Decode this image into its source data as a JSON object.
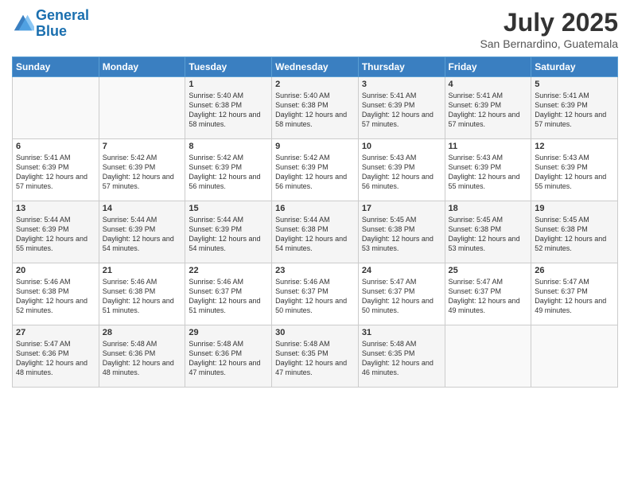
{
  "logo": {
    "line1": "General",
    "line2": "Blue"
  },
  "title": "July 2025",
  "subtitle": "San Bernardino, Guatemala",
  "days_header": [
    "Sunday",
    "Monday",
    "Tuesday",
    "Wednesday",
    "Thursday",
    "Friday",
    "Saturday"
  ],
  "weeks": [
    [
      {
        "num": "",
        "sunrise": "",
        "sunset": "",
        "daylight": ""
      },
      {
        "num": "",
        "sunrise": "",
        "sunset": "",
        "daylight": ""
      },
      {
        "num": "1",
        "sunrise": "Sunrise: 5:40 AM",
        "sunset": "Sunset: 6:38 PM",
        "daylight": "Daylight: 12 hours and 58 minutes."
      },
      {
        "num": "2",
        "sunrise": "Sunrise: 5:40 AM",
        "sunset": "Sunset: 6:38 PM",
        "daylight": "Daylight: 12 hours and 58 minutes."
      },
      {
        "num": "3",
        "sunrise": "Sunrise: 5:41 AM",
        "sunset": "Sunset: 6:39 PM",
        "daylight": "Daylight: 12 hours and 57 minutes."
      },
      {
        "num": "4",
        "sunrise": "Sunrise: 5:41 AM",
        "sunset": "Sunset: 6:39 PM",
        "daylight": "Daylight: 12 hours and 57 minutes."
      },
      {
        "num": "5",
        "sunrise": "Sunrise: 5:41 AM",
        "sunset": "Sunset: 6:39 PM",
        "daylight": "Daylight: 12 hours and 57 minutes."
      }
    ],
    [
      {
        "num": "6",
        "sunrise": "Sunrise: 5:41 AM",
        "sunset": "Sunset: 6:39 PM",
        "daylight": "Daylight: 12 hours and 57 minutes."
      },
      {
        "num": "7",
        "sunrise": "Sunrise: 5:42 AM",
        "sunset": "Sunset: 6:39 PM",
        "daylight": "Daylight: 12 hours and 57 minutes."
      },
      {
        "num": "8",
        "sunrise": "Sunrise: 5:42 AM",
        "sunset": "Sunset: 6:39 PM",
        "daylight": "Daylight: 12 hours and 56 minutes."
      },
      {
        "num": "9",
        "sunrise": "Sunrise: 5:42 AM",
        "sunset": "Sunset: 6:39 PM",
        "daylight": "Daylight: 12 hours and 56 minutes."
      },
      {
        "num": "10",
        "sunrise": "Sunrise: 5:43 AM",
        "sunset": "Sunset: 6:39 PM",
        "daylight": "Daylight: 12 hours and 56 minutes."
      },
      {
        "num": "11",
        "sunrise": "Sunrise: 5:43 AM",
        "sunset": "Sunset: 6:39 PM",
        "daylight": "Daylight: 12 hours and 55 minutes."
      },
      {
        "num": "12",
        "sunrise": "Sunrise: 5:43 AM",
        "sunset": "Sunset: 6:39 PM",
        "daylight": "Daylight: 12 hours and 55 minutes."
      }
    ],
    [
      {
        "num": "13",
        "sunrise": "Sunrise: 5:44 AM",
        "sunset": "Sunset: 6:39 PM",
        "daylight": "Daylight: 12 hours and 55 minutes."
      },
      {
        "num": "14",
        "sunrise": "Sunrise: 5:44 AM",
        "sunset": "Sunset: 6:39 PM",
        "daylight": "Daylight: 12 hours and 54 minutes."
      },
      {
        "num": "15",
        "sunrise": "Sunrise: 5:44 AM",
        "sunset": "Sunset: 6:39 PM",
        "daylight": "Daylight: 12 hours and 54 minutes."
      },
      {
        "num": "16",
        "sunrise": "Sunrise: 5:44 AM",
        "sunset": "Sunset: 6:38 PM",
        "daylight": "Daylight: 12 hours and 54 minutes."
      },
      {
        "num": "17",
        "sunrise": "Sunrise: 5:45 AM",
        "sunset": "Sunset: 6:38 PM",
        "daylight": "Daylight: 12 hours and 53 minutes."
      },
      {
        "num": "18",
        "sunrise": "Sunrise: 5:45 AM",
        "sunset": "Sunset: 6:38 PM",
        "daylight": "Daylight: 12 hours and 53 minutes."
      },
      {
        "num": "19",
        "sunrise": "Sunrise: 5:45 AM",
        "sunset": "Sunset: 6:38 PM",
        "daylight": "Daylight: 12 hours and 52 minutes."
      }
    ],
    [
      {
        "num": "20",
        "sunrise": "Sunrise: 5:46 AM",
        "sunset": "Sunset: 6:38 PM",
        "daylight": "Daylight: 12 hours and 52 minutes."
      },
      {
        "num": "21",
        "sunrise": "Sunrise: 5:46 AM",
        "sunset": "Sunset: 6:38 PM",
        "daylight": "Daylight: 12 hours and 51 minutes."
      },
      {
        "num": "22",
        "sunrise": "Sunrise: 5:46 AM",
        "sunset": "Sunset: 6:37 PM",
        "daylight": "Daylight: 12 hours and 51 minutes."
      },
      {
        "num": "23",
        "sunrise": "Sunrise: 5:46 AM",
        "sunset": "Sunset: 6:37 PM",
        "daylight": "Daylight: 12 hours and 50 minutes."
      },
      {
        "num": "24",
        "sunrise": "Sunrise: 5:47 AM",
        "sunset": "Sunset: 6:37 PM",
        "daylight": "Daylight: 12 hours and 50 minutes."
      },
      {
        "num": "25",
        "sunrise": "Sunrise: 5:47 AM",
        "sunset": "Sunset: 6:37 PM",
        "daylight": "Daylight: 12 hours and 49 minutes."
      },
      {
        "num": "26",
        "sunrise": "Sunrise: 5:47 AM",
        "sunset": "Sunset: 6:37 PM",
        "daylight": "Daylight: 12 hours and 49 minutes."
      }
    ],
    [
      {
        "num": "27",
        "sunrise": "Sunrise: 5:47 AM",
        "sunset": "Sunset: 6:36 PM",
        "daylight": "Daylight: 12 hours and 48 minutes."
      },
      {
        "num": "28",
        "sunrise": "Sunrise: 5:48 AM",
        "sunset": "Sunset: 6:36 PM",
        "daylight": "Daylight: 12 hours and 48 minutes."
      },
      {
        "num": "29",
        "sunrise": "Sunrise: 5:48 AM",
        "sunset": "Sunset: 6:36 PM",
        "daylight": "Daylight: 12 hours and 47 minutes."
      },
      {
        "num": "30",
        "sunrise": "Sunrise: 5:48 AM",
        "sunset": "Sunset: 6:35 PM",
        "daylight": "Daylight: 12 hours and 47 minutes."
      },
      {
        "num": "31",
        "sunrise": "Sunrise: 5:48 AM",
        "sunset": "Sunset: 6:35 PM",
        "daylight": "Daylight: 12 hours and 46 minutes."
      },
      {
        "num": "",
        "sunrise": "",
        "sunset": "",
        "daylight": ""
      },
      {
        "num": "",
        "sunrise": "",
        "sunset": "",
        "daylight": ""
      }
    ]
  ]
}
